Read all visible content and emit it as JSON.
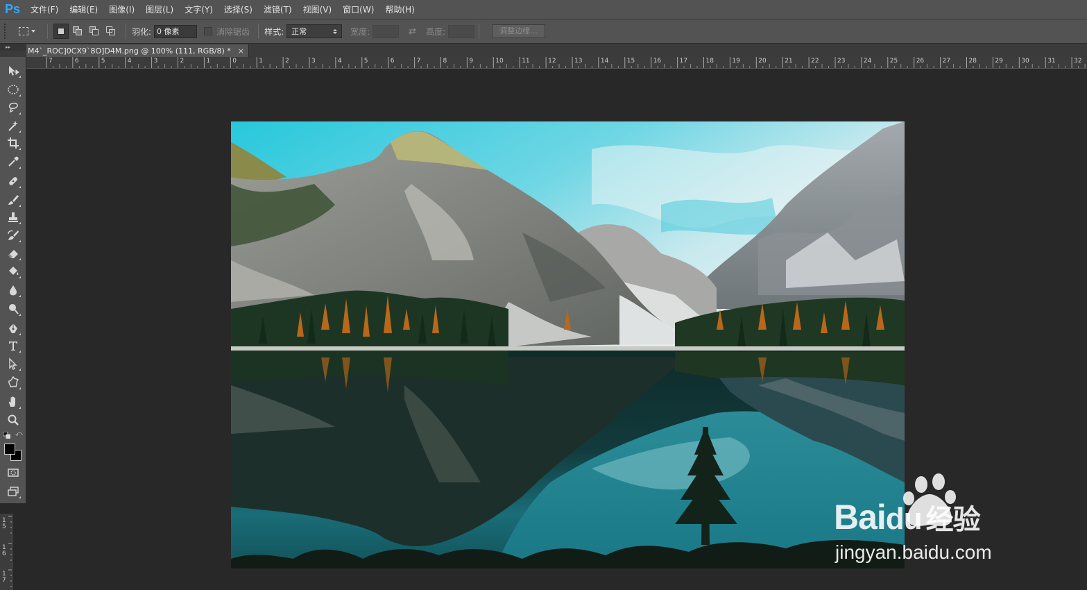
{
  "app": {
    "logo": "Ps",
    "accent_color": "#31a8ff"
  },
  "menu": [
    "文件(F)",
    "编辑(E)",
    "图像(I)",
    "图层(L)",
    "文字(Y)",
    "选择(S)",
    "滤镜(T)",
    "视图(V)",
    "窗口(W)",
    "帮助(H)"
  ],
  "options": {
    "feather_label": "羽化:",
    "feather_value": "0 像素",
    "antialias_label": "消除锯齿",
    "style_label": "样式:",
    "style_value": "正常",
    "width_label": "宽度:",
    "height_label": "高度:",
    "refine_edge_label": "调整边缘..."
  },
  "document": {
    "tab_title": "M4`_ROC]0CX9`8O]D4M.png @ 100% (111, RGB/8) *",
    "close_glyph": "×"
  },
  "ruler": {
    "h_labels": [
      "7",
      "6",
      "5",
      "4",
      "3",
      "2",
      "1",
      "0",
      "1",
      "2",
      "3",
      "4",
      "5",
      "6",
      "7",
      "8",
      "9",
      "10",
      "11",
      "12",
      "13",
      "14",
      "15",
      "16",
      "17",
      "18",
      "19",
      "20",
      "21",
      "22",
      "23",
      "24",
      "25",
      "26",
      "27",
      "28",
      "29",
      "30",
      "31",
      "32"
    ],
    "v_labels": [
      "1 5",
      "1 6",
      "1 7"
    ]
  },
  "toolbox": {
    "tools": [
      {
        "name": "move-tool-icon"
      },
      {
        "name": "elliptical-marquee-icon"
      },
      {
        "name": "lasso-icon"
      },
      {
        "name": "magic-wand-icon"
      },
      {
        "name": "crop-icon"
      },
      {
        "name": "eyedropper-icon"
      },
      {
        "name": "healing-brush-icon"
      },
      {
        "name": "brush-icon"
      },
      {
        "name": "clone-stamp-icon"
      },
      {
        "name": "history-brush-icon"
      },
      {
        "name": "eraser-icon"
      },
      {
        "name": "paint-bucket-icon"
      },
      {
        "name": "blur-icon"
      },
      {
        "name": "dodge-icon"
      },
      {
        "name": "pen-icon"
      },
      {
        "name": "type-icon"
      },
      {
        "name": "path-selection-icon"
      },
      {
        "name": "custom-shape-icon"
      },
      {
        "name": "hand-icon"
      },
      {
        "name": "zoom-icon"
      }
    ],
    "foreground_color": "#000000",
    "background_color": "#000000"
  },
  "watermark": {
    "brand": "Bai",
    "brand2": "du",
    "suffix": "经验",
    "url": "jingyan.baidu.com"
  }
}
